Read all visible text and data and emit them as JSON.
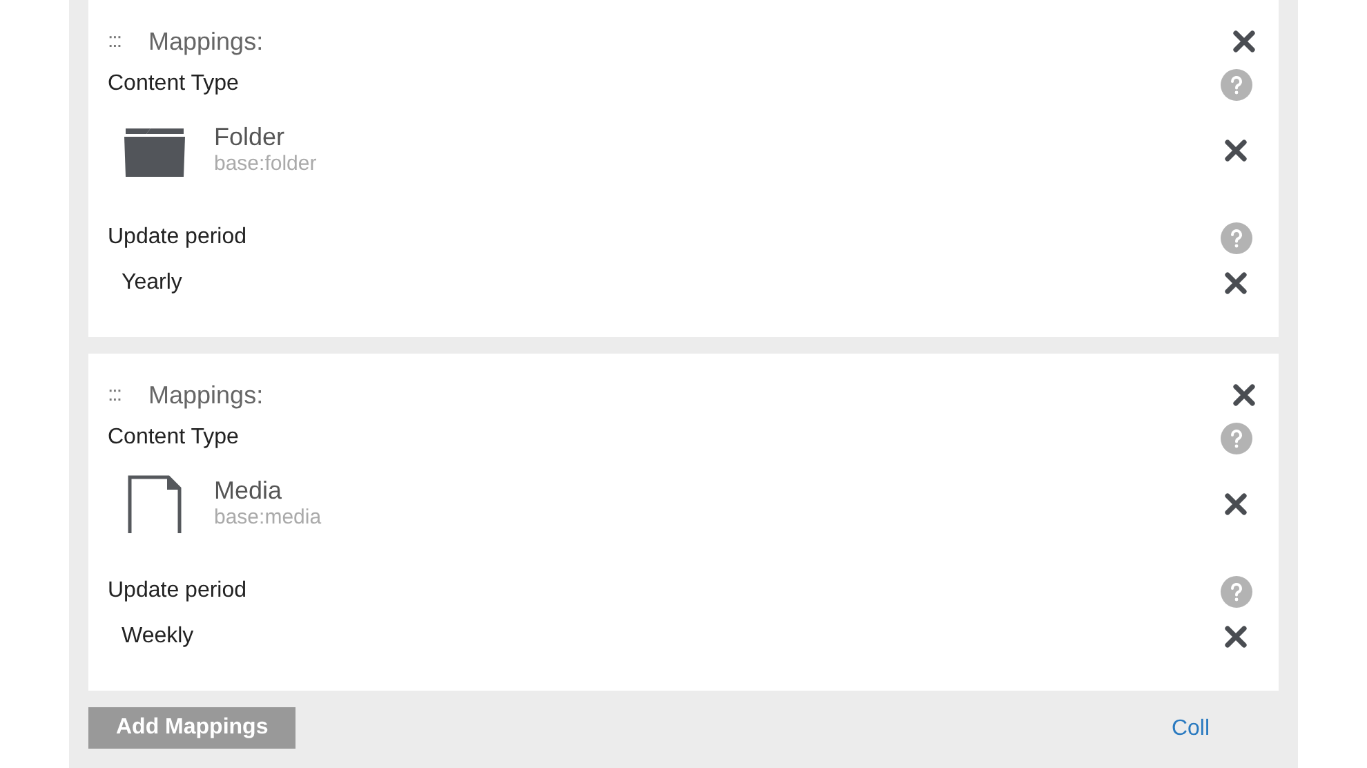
{
  "mappings": [
    {
      "handle": ":::",
      "title": "Mappings:",
      "content_type": {
        "label": "Content Type",
        "kind": "folder",
        "name": "Folder",
        "id": "base:folder"
      },
      "update_period": {
        "label": "Update period",
        "value": "Yearly"
      }
    },
    {
      "handle": ":::",
      "title": "Mappings:",
      "content_type": {
        "label": "Content Type",
        "kind": "file",
        "name": "Media",
        "id": "base:media"
      },
      "update_period": {
        "label": "Update period",
        "value": "Weekly"
      }
    }
  ],
  "add_button": "Add Mappings",
  "link": "Coll"
}
